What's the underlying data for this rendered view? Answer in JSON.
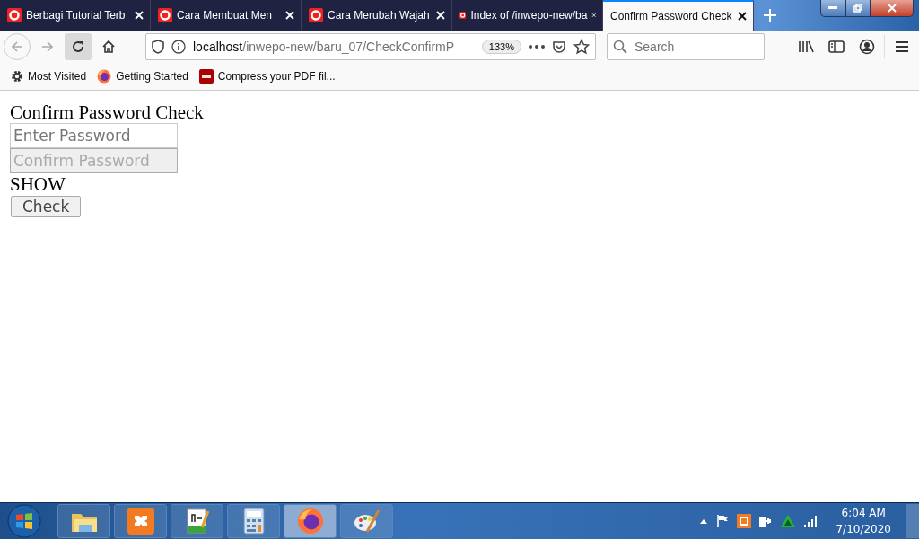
{
  "tabs": [
    {
      "title": "Berbagi Tutorial Terb",
      "selected": false
    },
    {
      "title": "Cara Membuat Men",
      "selected": false
    },
    {
      "title": "Cara Merubah Wajah",
      "selected": false
    },
    {
      "title": "Index of /inwepo-new/ba",
      "selected": false
    },
    {
      "title": "Confirm Password Check",
      "selected": true
    }
  ],
  "address": {
    "host": "localhost",
    "path": "/inwepo-new/baru_07/CheckConfirmP",
    "zoom": "133%"
  },
  "search": {
    "placeholder": "Search"
  },
  "bookmarks": [
    {
      "label": "Most Visited",
      "kind": "gear"
    },
    {
      "label": "Getting Started",
      "kind": "firefox"
    },
    {
      "label": "Compress your PDF fil...",
      "kind": "pdf"
    }
  ],
  "page": {
    "heading": "Confirm Password Check",
    "fields": [
      {
        "placeholder": "Enter Password",
        "disabled": false
      },
      {
        "placeholder": "Confirm Password",
        "disabled": true
      }
    ],
    "toggle": "SHOW",
    "button": "Check"
  },
  "taskbar": {
    "apps": [
      {
        "kind": "folder",
        "selected": false
      },
      {
        "kind": "xampp",
        "selected": false
      },
      {
        "kind": "notepad",
        "selected": false
      },
      {
        "kind": "calculator",
        "selected": false
      },
      {
        "kind": "firefox",
        "selected": true
      },
      {
        "kind": "paint",
        "selected": false
      }
    ],
    "time": "6:04 AM",
    "date": "7/10/2020"
  }
}
